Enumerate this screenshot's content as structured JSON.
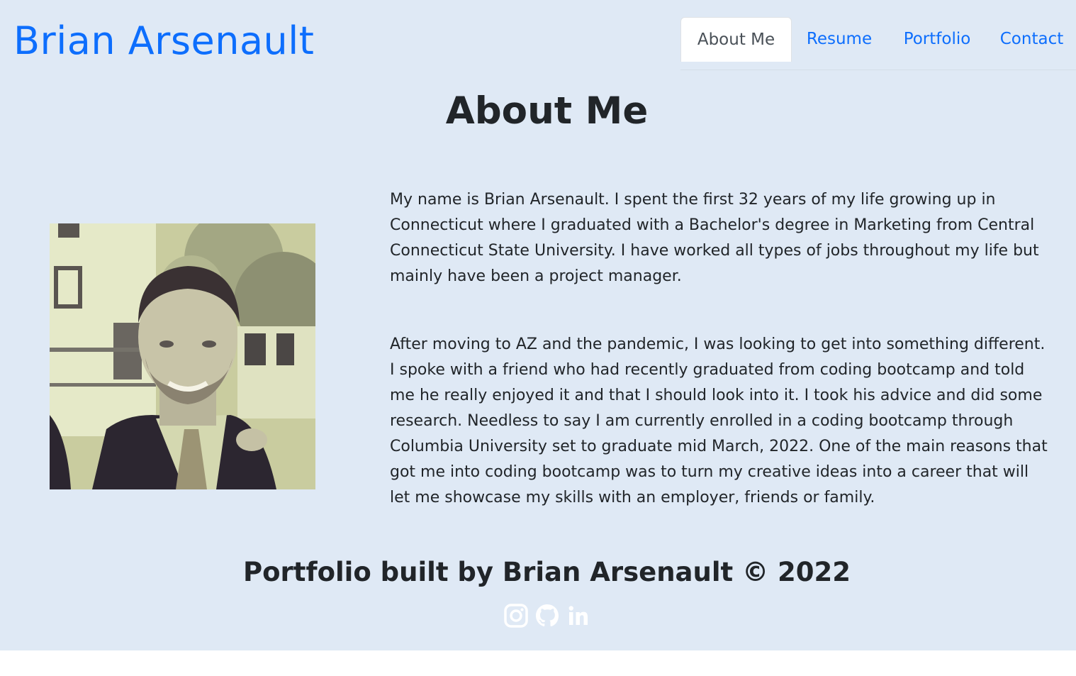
{
  "header": {
    "brand": "Brian Arsenault",
    "nav": [
      {
        "label": "About Me",
        "active": true
      },
      {
        "label": "Resume",
        "active": false
      },
      {
        "label": "Portfolio",
        "active": false
      },
      {
        "label": "Contact",
        "active": false
      }
    ]
  },
  "main": {
    "title": "About Me",
    "paragraphs": [
      "My name is Brian Arsenault. I spent the first 32 years of my life growing up in Connecticut where I graduated with a Bachelor's degree in Marketing from Central Connecticut State University. I have worked all types of jobs throughout my life but mainly have been a project manager.",
      "After moving to AZ and the pandemic, I was looking to get into something different. I spoke with a friend who had recently graduated from coding bootcamp and told me he really enjoyed it and that I should look into it. I took his advice and did some research. Needless to say I am currently enrolled in a coding bootcamp through Columbia University set to graduate mid March, 2022. One of the main reasons that got me into coding bootcamp was to turn my creative ideas into a career that will let me showcase my skills with an employer, friends or family."
    ]
  },
  "footer": {
    "text": "Portfolio built by Brian Arsenault © 2022",
    "icons": [
      "instagram-icon",
      "github-icon",
      "linkedin-icon"
    ]
  },
  "colors": {
    "background": "#dfe9f5",
    "brand": "#0d6efd",
    "text": "#212529",
    "icon": "#ffffff"
  }
}
